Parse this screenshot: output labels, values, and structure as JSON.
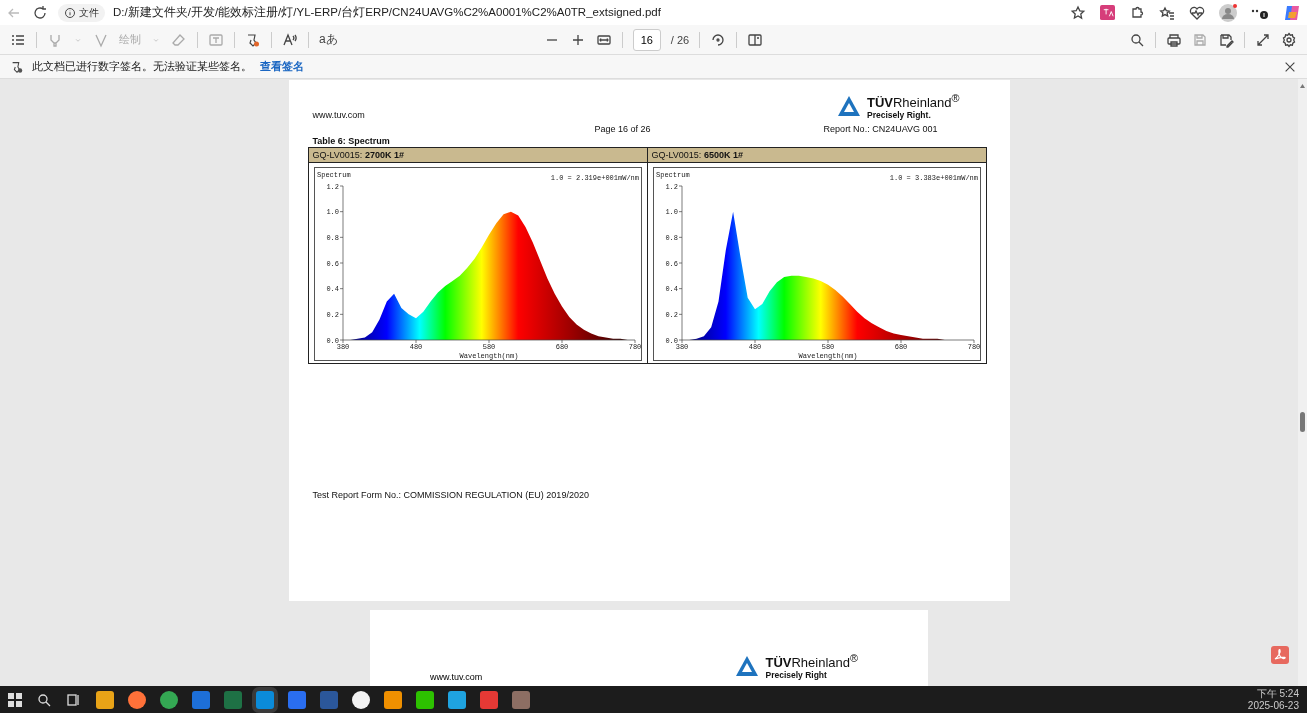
{
  "browser": {
    "address_label": "文件",
    "url": "D:/新建文件夹/开发/能效标注册/灯/YL-ERP/台灯ERP/CN24UAVG%C2%A0001%C2%A0TR_extsigned.pdf"
  },
  "pdf_toolbar": {
    "draw_label": "绘制",
    "text_icon": "aあ",
    "page_input": "16",
    "page_total": "/ 26"
  },
  "signature_bar": {
    "message": "此文档已进行数字签名。无法验证某些签名。",
    "link": "查看签名"
  },
  "page": {
    "website": "www.tuv.com",
    "logo_name": "**TÜV**Rheinland$^{®}$",
    "slogan": "Precisely Right.",
    "page_label": "Page  16  of 26",
    "report_no": "Report No.: CN24UAVG 001",
    "table_title": "Table 6: Spectrum",
    "columns": [
      {
        "header": "GQ-LV0015: **2700K 1#**",
        "chart_data": {
          "type": "area",
          "xlabel": "Wavelength(nm)",
          "annotations": [
            "1.0 = 2.319e+001mW/nm"
          ],
          "xlim": [
            380,
            780
          ],
          "ylim": [
            0,
            1.2
          ],
          "xticks": [
            380,
            480,
            580,
            680,
            780
          ],
          "yticks": [
            {
              "value": 0,
              "label": "0.0"
            },
            {
              "value": 0.2,
              "label": "0.2"
            },
            {
              "value": 0.4,
              "label": "0.4"
            },
            {
              "value": 0.6,
              "label": "0.6"
            },
            {
              "value": 0.8,
              "label": "0.8"
            },
            {
              "value": 1,
              "label": "1.0"
            },
            {
              "value": 1.2,
              "label": "1.2"
            }
          ],
          "x": [
            380,
            390,
            400,
            410,
            420,
            430,
            440,
            450,
            460,
            470,
            480,
            490,
            500,
            510,
            520,
            530,
            540,
            550,
            560,
            570,
            580,
            590,
            600,
            610,
            620,
            630,
            640,
            650,
            660,
            670,
            680,
            690,
            700,
            710,
            720,
            730,
            740,
            750,
            760,
            770,
            780
          ],
          "series": [
            {
              "name": "Spectrum",
              "values": [
                0,
                0,
                0.01,
                0.02,
                0.06,
                0.16,
                0.3,
                0.36,
                0.25,
                0.2,
                0.17,
                0.22,
                0.3,
                0.37,
                0.42,
                0.46,
                0.5,
                0.56,
                0.63,
                0.72,
                0.82,
                0.91,
                0.98,
                1.0,
                0.97,
                0.88,
                0.76,
                0.62,
                0.48,
                0.36,
                0.26,
                0.18,
                0.12,
                0.08,
                0.05,
                0.03,
                0.02,
                0.01,
                0.01,
                0,
                0
              ]
            }
          ]
        }
      },
      {
        "header": "GQ-LV0015: **6500K 1#**",
        "chart_data": {
          "type": "area",
          "xlabel": "Wavelength(nm)",
          "annotations": [
            "1.0 = 3.383e+001mW/nm"
          ],
          "xlim": [
            380,
            780
          ],
          "ylim": [
            0,
            1.2
          ],
          "xticks": [
            380,
            480,
            580,
            680,
            780
          ],
          "yticks": [
            {
              "value": 0,
              "label": "0.0"
            },
            {
              "value": 0.2,
              "label": "0.2"
            },
            {
              "value": 0.4,
              "label": "0.4"
            },
            {
              "value": 0.6,
              "label": "0.6"
            },
            {
              "value": 0.8,
              "label": "0.8"
            },
            {
              "value": 1,
              "label": "1.0"
            },
            {
              "value": 1.2,
              "label": "1.2"
            }
          ],
          "x": [
            380,
            390,
            400,
            410,
            420,
            430,
            440,
            450,
            460,
            470,
            480,
            490,
            500,
            510,
            520,
            530,
            540,
            550,
            560,
            570,
            580,
            590,
            600,
            610,
            620,
            630,
            640,
            650,
            660,
            670,
            680,
            690,
            700,
            710,
            720,
            730,
            740,
            750,
            760,
            770,
            780
          ],
          "series": [
            {
              "name": "Spectrum",
              "values": [
                0,
                0,
                0.01,
                0.03,
                0.1,
                0.3,
                0.7,
                1.0,
                0.65,
                0.33,
                0.24,
                0.28,
                0.38,
                0.45,
                0.49,
                0.5,
                0.5,
                0.49,
                0.48,
                0.46,
                0.43,
                0.39,
                0.34,
                0.28,
                0.22,
                0.17,
                0.13,
                0.1,
                0.07,
                0.05,
                0.04,
                0.03,
                0.02,
                0.01,
                0.01,
                0.01,
                0,
                0,
                0,
                0,
                0
              ]
            }
          ]
        }
      }
    ],
    "footer": "Test Report Form No.: COMMISSION REGULATION (EU) 2019/2020"
  },
  "next_page": {
    "website": "www.tuv.com",
    "logo_name": "**TÜV**Rheinland$^{®}$",
    "slogan": "Precisely Right"
  },
  "taskbar": {
    "time": "下午 5:24",
    "date": "2025-06-23"
  }
}
